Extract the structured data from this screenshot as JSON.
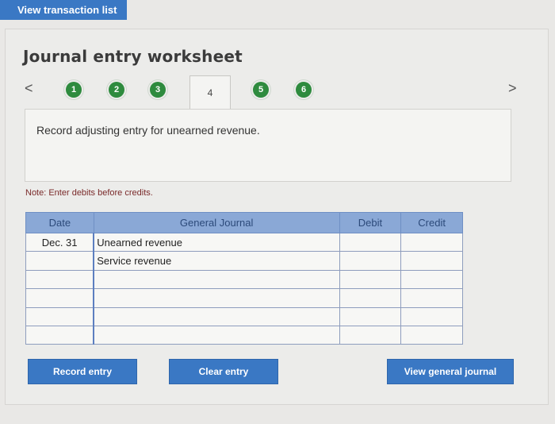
{
  "top_button": "View transaction list",
  "title": "Journal entry worksheet",
  "nav": {
    "prev": "<",
    "next": ">"
  },
  "steps": [
    "1",
    "2",
    "3",
    "4",
    "5",
    "6"
  ],
  "active_step": "4",
  "instruction": "Record adjusting entry for unearned revenue.",
  "note": "Note: Enter debits before credits.",
  "table": {
    "headers": [
      "Date",
      "General Journal",
      "Debit",
      "Credit"
    ],
    "rows": [
      {
        "date": "Dec. 31",
        "account": "Unearned revenue",
        "debit": "",
        "credit": ""
      },
      {
        "date": "",
        "account": "Service revenue",
        "debit": "",
        "credit": ""
      },
      {
        "date": "",
        "account": "",
        "debit": "",
        "credit": ""
      },
      {
        "date": "",
        "account": "",
        "debit": "",
        "credit": ""
      },
      {
        "date": "",
        "account": "",
        "debit": "",
        "credit": ""
      },
      {
        "date": "",
        "account": "",
        "debit": "",
        "credit": ""
      }
    ]
  },
  "buttons": {
    "record": "Record entry",
    "clear": "Clear entry",
    "view_journal": "View general journal"
  },
  "colors": {
    "accent": "#3a78c4",
    "step_complete": "#2e8b3e",
    "table_header": "#8aa8d6"
  }
}
